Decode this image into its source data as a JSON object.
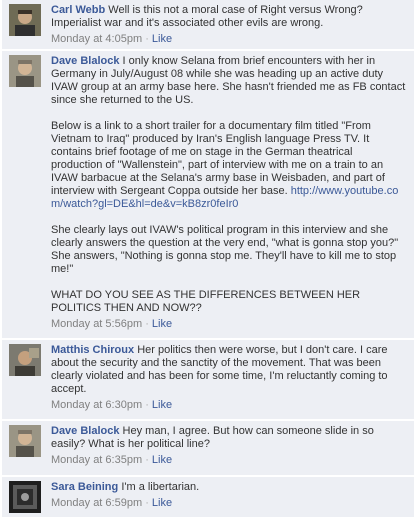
{
  "comments": [
    {
      "author": "Carl Webb",
      "text": "Well is this not a moral case of Right versus Wrong? Imperialist war and it's associated other evils are wrong.",
      "time": "Monday at 4:05pm",
      "action": "Like",
      "avatar_icon": "profile-photo-carl"
    },
    {
      "author": "Dave Blalock",
      "text_before_link": "I only know Selana from brief encounters with her in Germany in July/August 08 while she was heading up an active duty IVAW group at an army base here. She hasn't friended me as FB contact since she returned to the US.\n\nBelow is a link to a short trailer for a documentary film titled \"From Vietnam to Iraq\" produced by Iran's English language Press TV. It contains brief footage of me on stage in the German theatrical production of \"Wallenstein\", part of interview with me on a train to an IVAW barbacue at the Selana's army base in Weisbaden, and part of interview with Sergeant Coppa outside her base. ",
      "link": "http://www.youtube.com/watch?gl=DE&hl=de&v=kB8zr0feIr0",
      "text_after_link": "\n\nShe clearly lays out IVAW's political program in this interview and she clearly answers the question at the very end, \"what is gonna stop you?\" She answers, \"Nothing is gonna stop me. They'll have to kill me to stop me!\"\n\nWHAT DO YOU SEE AS THE DIFFERENCES BETWEEN HER POLITICS THEN AND NOW??",
      "time": "Monday at 5:56pm",
      "action": "Like",
      "avatar_icon": "profile-photo-dave"
    },
    {
      "author": "Matthis Chiroux",
      "text": "Her politics then were worse, but I don't care. I care about the security and the sanctity of the movement. That was been clearly violated and has been for some time, I'm reluctantly coming to accept.",
      "time": "Monday at 6:30pm",
      "action": "Like",
      "avatar_icon": "profile-photo-matthis"
    },
    {
      "author": "Dave Blalock",
      "text": "Hey man, I agree. But how can someone slide in so easily? What is her political line?",
      "time": "Monday at 6:35pm",
      "action": "Like",
      "avatar_icon": "profile-photo-dave"
    },
    {
      "author": "Sara Beining",
      "text": "I'm a libertarian.",
      "time": "Monday at 6:59pm",
      "action": "Like",
      "avatar_icon": "profile-photo-sara"
    }
  ]
}
